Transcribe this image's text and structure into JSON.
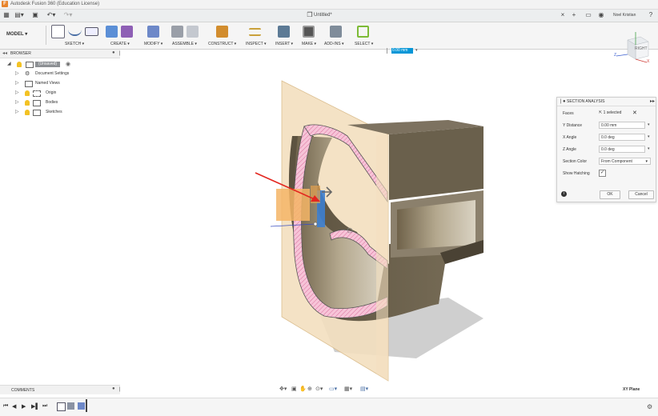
{
  "window": {
    "title": "Autodesk Fusion 360 (Education License)"
  },
  "tabbar": {
    "doc_title": "Untitled*",
    "user_name": "Noel Kristian"
  },
  "toolbar": {
    "workspace": "MODEL",
    "groups": [
      {
        "label": "SKETCH"
      },
      {
        "label": "CREATE"
      },
      {
        "label": "MODIFY"
      },
      {
        "label": "ASSEMBLE"
      },
      {
        "label": "CONSTRUCT"
      },
      {
        "label": "INSPECT"
      },
      {
        "label": "INSERT"
      },
      {
        "label": "MAKE"
      },
      {
        "label": "ADD-INS"
      },
      {
        "label": "SELECT"
      }
    ],
    "quick_value": "0.00 mm"
  },
  "browser": {
    "title": "BROWSER",
    "root": "(Unsaved)",
    "items": [
      {
        "label": "Document Settings"
      },
      {
        "label": "Named Views"
      },
      {
        "label": "Origin"
      },
      {
        "label": "Bodies"
      },
      {
        "label": "Sketches"
      }
    ]
  },
  "viewcube": {
    "face_right": "RIGHT",
    "axis_z": "Z",
    "axis_x": "X"
  },
  "section_panel": {
    "title": "SECTION ANALYSIS",
    "rows": [
      {
        "label": "Faces",
        "value": "1 selected"
      },
      {
        "label": "Y Distance",
        "value": "0.00 mm"
      },
      {
        "label": "X Angle",
        "value": "0.0 deg"
      },
      {
        "label": "Z Angle",
        "value": "0.0 deg"
      },
      {
        "label": "Section Color",
        "value": "From Component"
      },
      {
        "label": "Show Hatching",
        "checked": true
      }
    ],
    "ok_label": "OK",
    "cancel_label": "Cancel"
  },
  "comments": {
    "title": "COMMENTS"
  },
  "status": {
    "plane": "XY Plane"
  },
  "colors": {
    "accent": "#0696d7",
    "hatch": "#f2a6c4",
    "plane": "#f5deb6",
    "body": "#6e6450"
  }
}
